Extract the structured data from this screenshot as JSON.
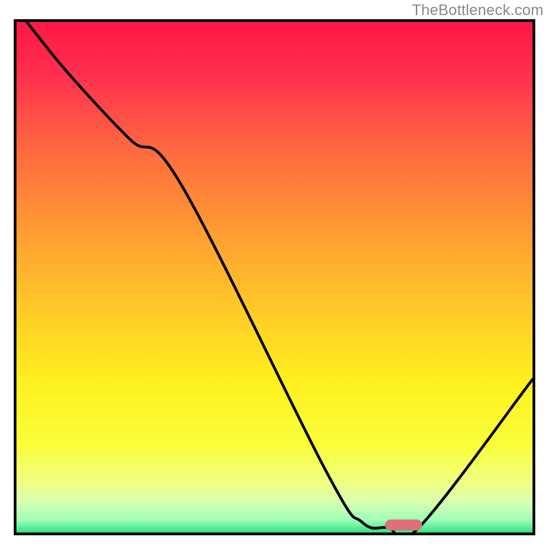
{
  "watermark": "TheBottleneck.com",
  "chart_data": {
    "type": "line",
    "title": "",
    "xlabel": "",
    "ylabel": "",
    "xlim": [
      0,
      100
    ],
    "ylim": [
      0,
      100
    ],
    "series": [
      {
        "name": "curve",
        "x": [
          2,
          10,
          22,
          32,
          60,
          67,
          72,
          78,
          100
        ],
        "y": [
          100,
          90,
          77,
          68,
          12,
          2,
          1,
          1,
          30
        ]
      }
    ],
    "marker": {
      "name": "optimal-region",
      "x": 75,
      "y": 1.5,
      "color": "#e07078"
    },
    "background_gradient": {
      "stops": [
        {
          "offset": 0.0,
          "color": "#ff1744"
        },
        {
          "offset": 0.1,
          "color": "#ff2f4e"
        },
        {
          "offset": 0.25,
          "color": "#ff6a3f"
        },
        {
          "offset": 0.4,
          "color": "#ff9a33"
        },
        {
          "offset": 0.55,
          "color": "#ffc828"
        },
        {
          "offset": 0.7,
          "color": "#fff01f"
        },
        {
          "offset": 0.82,
          "color": "#faff3a"
        },
        {
          "offset": 0.89,
          "color": "#f0ff80"
        },
        {
          "offset": 0.93,
          "color": "#d9ffb0"
        },
        {
          "offset": 0.965,
          "color": "#9fffb8"
        },
        {
          "offset": 0.99,
          "color": "#30e080"
        },
        {
          "offset": 1.0,
          "color": "#18c070"
        }
      ]
    }
  }
}
